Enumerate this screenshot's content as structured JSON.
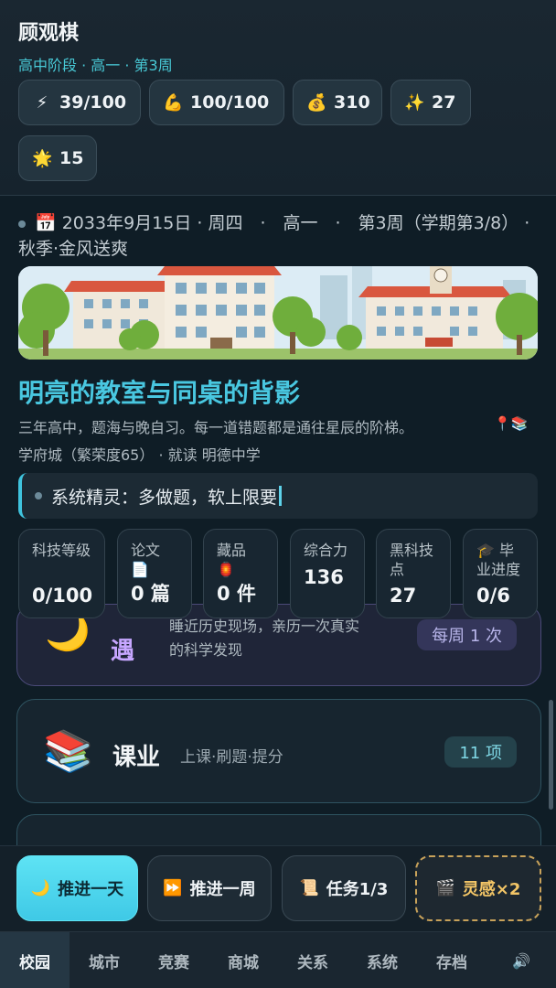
{
  "player": {
    "name": "顾观棋",
    "subtitle": "高中阶段 · 高一 · 第3周"
  },
  "stats": [
    {
      "icon": "⚡",
      "icon_name": "energy-bolt-icon",
      "value": "39/100"
    },
    {
      "icon": "💪",
      "icon_name": "strength-arm-icon",
      "value": "100/100"
    },
    {
      "icon": "💰",
      "icon_name": "money-bag-icon",
      "value": "310"
    },
    {
      "icon": "✨",
      "icon_name": "sparkle-icon",
      "value": "27"
    },
    {
      "icon": "🌟",
      "icon_name": "star-icon",
      "value": "15"
    }
  ],
  "date": {
    "icon": "📅",
    "text": "2033年9月15日 · 周四　·　高一　·　第3周（学期第3/8） · 秋季·金风送爽"
  },
  "location": {
    "title": "明亮的教室与同桌的背影",
    "desc": "三年高中，题海与晚自习。每一道错题都是通往星辰的阶梯。",
    "icons": "📍📚",
    "place": "学府城（繁荣度65） · 就读 明德中学"
  },
  "sprite": {
    "text": "系统精灵：多做题，软上限要"
  },
  "metrics": [
    {
      "label": "科技等级",
      "value": "0/100"
    },
    {
      "label": "论文 📄",
      "value": "0 篇"
    },
    {
      "label": "藏品 🏮",
      "value": "0 件"
    },
    {
      "label": "综合力",
      "value": "136"
    },
    {
      "label": "黑科技点",
      "value": "27"
    },
    {
      "label": "🎓 毕业进度",
      "value": "0/6"
    }
  ],
  "cards": {
    "encounter": {
      "icon": "🌙",
      "icon_name": "moon-icon",
      "title_fragment": "遇",
      "desc_line1": "睡近历史现场，亲历一次真实",
      "desc_line2": "的科学发现",
      "badge": "每周 1 次"
    },
    "study": {
      "icon": "📚",
      "icon_name": "books-icon",
      "title": "课业",
      "subtitle": "上课·刷题·提分",
      "badge": "11 项"
    }
  },
  "actions": [
    {
      "icon": "🌙",
      "label": "推进一天"
    },
    {
      "icon": "⏩",
      "label": "推进一周"
    },
    {
      "icon": "📜",
      "label": "任务1/3"
    },
    {
      "icon": "🎬",
      "label": "灵感×2"
    }
  ],
  "nav": [
    "校园",
    "城市",
    "竞赛",
    "商城",
    "关系",
    "系统",
    "存档"
  ],
  "nav_sound_icon": "🔊",
  "colors": {
    "accent": "#49c7e0",
    "background": "#0f1d26",
    "inspiration": "#f2c566"
  }
}
